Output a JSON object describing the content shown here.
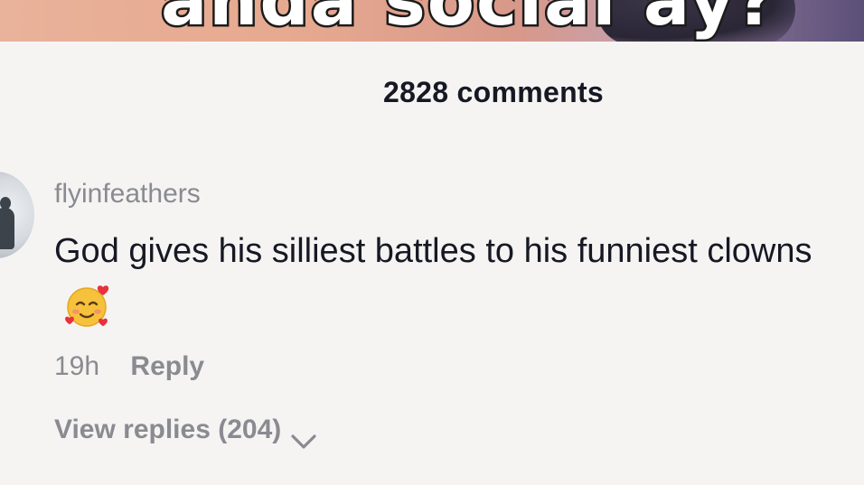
{
  "video": {
    "caption_fragment": "anda social ay?"
  },
  "comments_header": {
    "count_label": "2828 comments"
  },
  "comment": {
    "avatar_icon": "user-avatar",
    "username": "flyinfeathers",
    "text": "God gives his silliest battles to his funniest clowns",
    "emoji_icon": "smiling-face-with-hearts-icon",
    "timestamp": "19h",
    "reply_label": "Reply",
    "view_replies_label": "View replies (204)",
    "view_replies_icon": "chevron-down-icon"
  },
  "colors": {
    "background": "#f5f4f3",
    "primary_text": "#161823",
    "secondary_text": "#8a8b91"
  }
}
